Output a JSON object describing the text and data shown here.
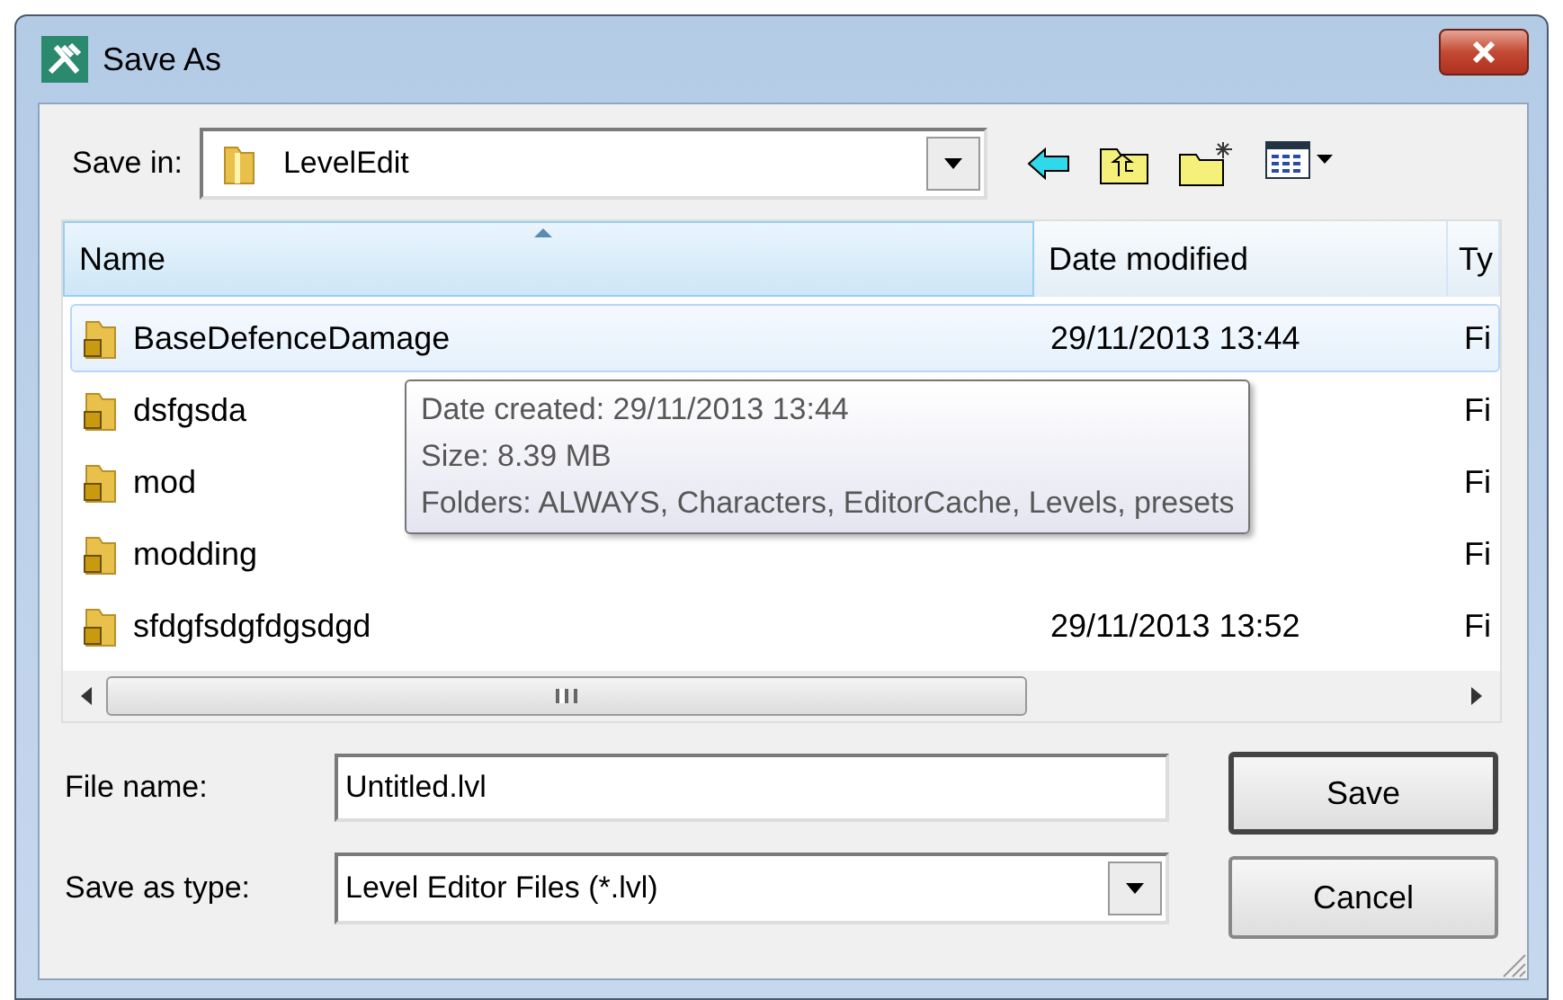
{
  "window": {
    "title": "Save As"
  },
  "save_in": {
    "label": "Save in:",
    "value": "LevelEdit"
  },
  "list": {
    "columns": [
      {
        "label": "Name",
        "sorted": true
      },
      {
        "label": "Date modified",
        "sorted": false
      },
      {
        "label": "Ty",
        "sorted": false
      }
    ],
    "rows": [
      {
        "name": "BaseDefenceDamage",
        "date": "29/11/2013 13:44",
        "type": "Fi",
        "selected": true
      },
      {
        "name": "dsfgsda",
        "type": "Fi",
        "selected": false
      },
      {
        "name": "mod",
        "type": "Fi",
        "selected": false
      },
      {
        "name": "modding",
        "type": "Fi",
        "selected": false
      },
      {
        "name": "sfdgfsdgfdgsdgd",
        "date": "29/11/2013 13:52",
        "type": "Fi",
        "selected": false
      }
    ],
    "tooltip": {
      "lines": [
        "Date created: 29/11/2013 13:44",
        "Size: 8.39 MB",
        "Folders: ALWAYS, Characters, EditorCache, Levels, presets"
      ]
    }
  },
  "file_name": {
    "label": "File name:",
    "value": "Untitled.lvl"
  },
  "save_type": {
    "label": "Save as type:",
    "value": "Level Editor Files (*.lvl)"
  },
  "buttons": [
    {
      "label": "Save",
      "default": true
    },
    {
      "label": "Cancel",
      "default": false
    }
  ]
}
